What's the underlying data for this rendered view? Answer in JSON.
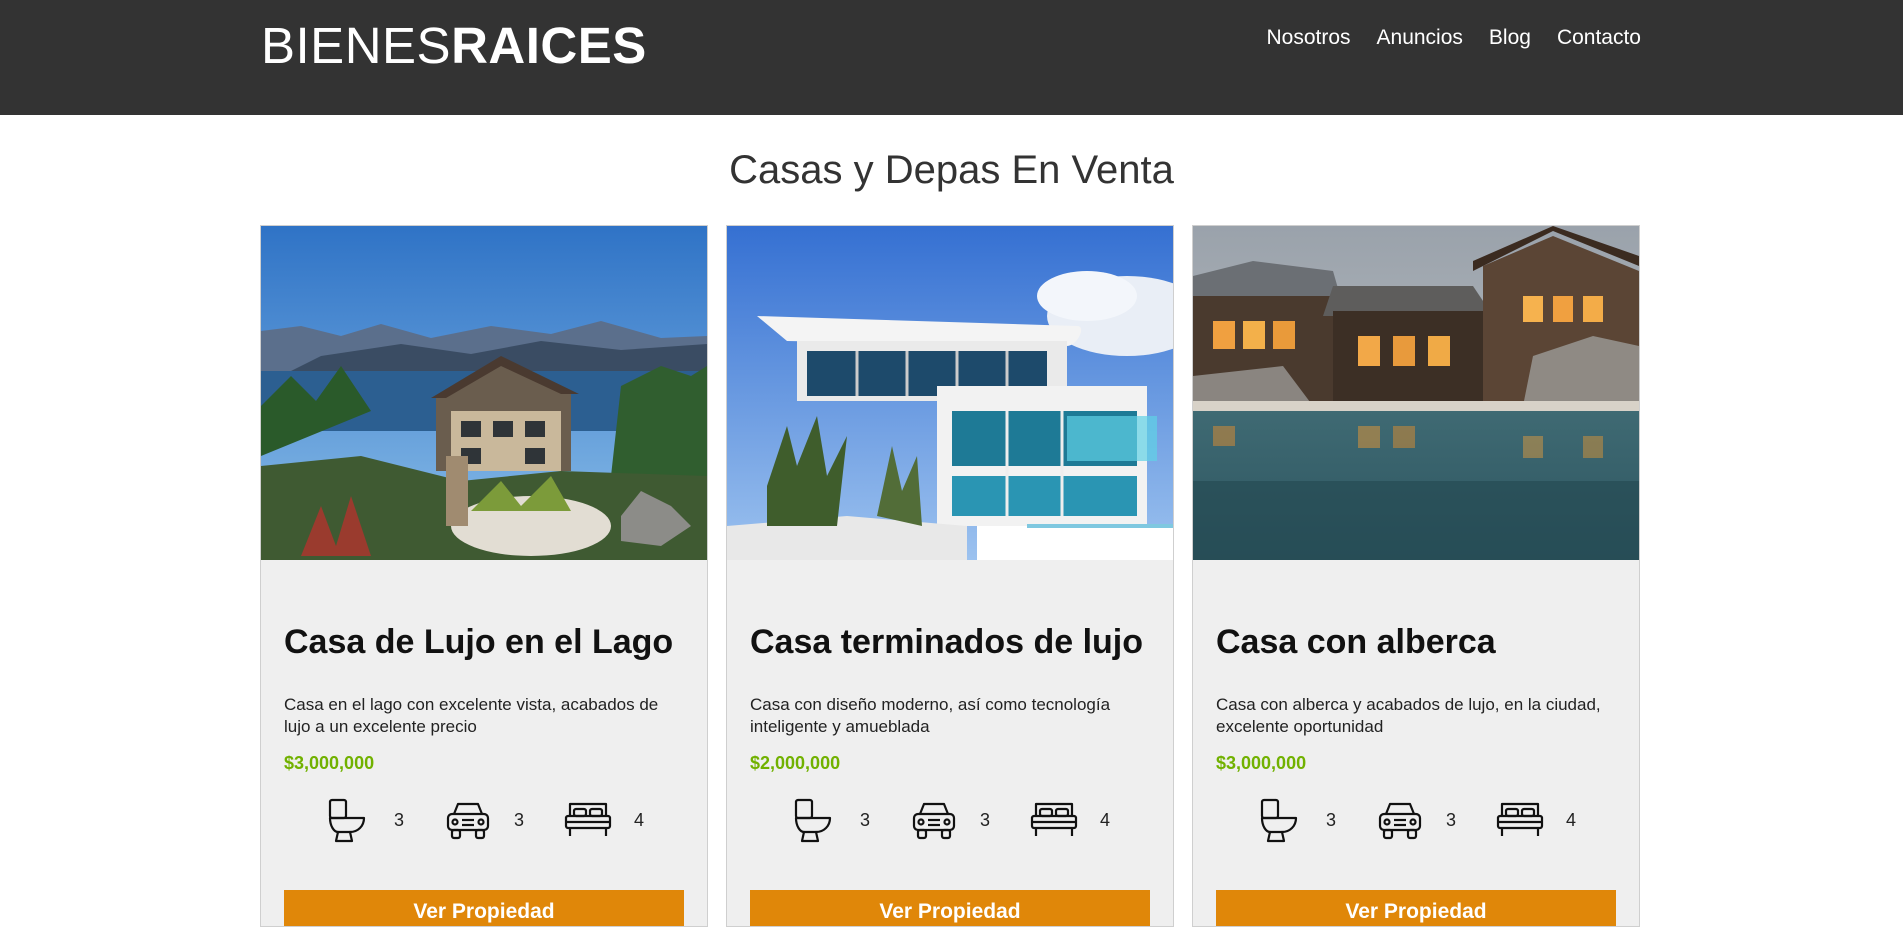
{
  "header": {
    "logo_thin": "BIENES",
    "logo_bold": "RAICES",
    "nav": [
      "Nosotros",
      "Anuncios",
      "Blog",
      "Contacto"
    ]
  },
  "section_title": "Casas y Depas En Venta",
  "colors": {
    "header_bg": "#333333",
    "price": "#71b100",
    "button": "#e08709",
    "card_bg": "#efefef"
  },
  "cards": [
    {
      "title": "Casa de Lujo en el Lago",
      "description": "Casa en el lago con excelente vista, acabados de lujo a un excelente precio",
      "price": "$3,000,000",
      "baths": "3",
      "parking": "3",
      "rooms": "4",
      "button": "Ver Propiedad"
    },
    {
      "title": "Casa terminados de lujo",
      "description": "Casa con diseño moderno, así como tecnología inteligente y amueblada",
      "price": "$2,000,000",
      "baths": "3",
      "parking": "3",
      "rooms": "4",
      "button": "Ver Propiedad"
    },
    {
      "title": "Casa con alberca",
      "description": "Casa con alberca y acabados de lujo, en la ciudad, excelente oportunidad",
      "price": "$3,000,000",
      "baths": "3",
      "parking": "3",
      "rooms": "4",
      "button": "Ver Propiedad"
    }
  ]
}
